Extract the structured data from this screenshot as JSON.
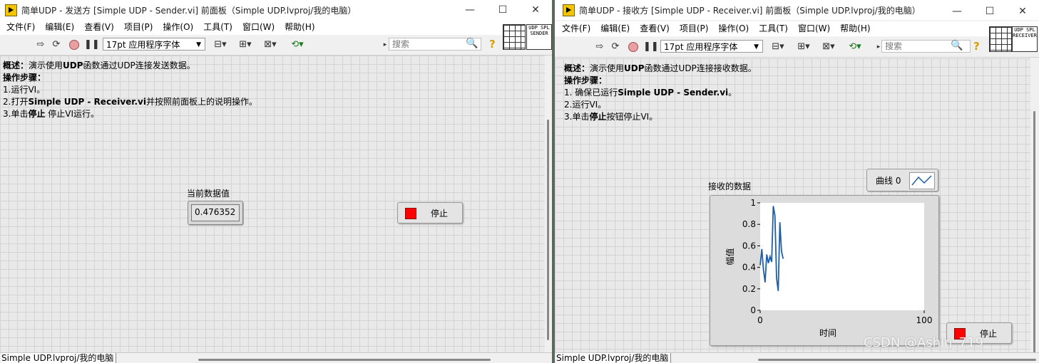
{
  "sender": {
    "title": "简单UDP - 发送方 [Simple UDP - Sender.vi] 前面板（Simple UDP.lvproj/我的电脑）",
    "menu": [
      "文件(F)",
      "编辑(E)",
      "查看(V)",
      "项目(P)",
      "操作(O)",
      "工具(T)",
      "窗口(W)",
      "帮助(H)"
    ],
    "font": "17pt 应用程序字体",
    "search_placeholder": "搜索",
    "vi_icon_text": "UDP SPL SENDER",
    "desc": {
      "l1_prefix": "概述：",
      "l1_a": "演示使用",
      "l1_bold": "UDP",
      "l1_b": "函数通过UDP连接发送数据。",
      "l2": "操作步骤：",
      "l3": "1.运行VI。",
      "l4_a": "2.打开",
      "l4_bold": "Simple UDP - Receiver.vi",
      "l4_b": "并按照前面板上的说明操作。",
      "l5_a": "3.单击",
      "l5_bold": "停止",
      "l5_b": " 停止VI运行。"
    },
    "indicator_label": "当前数据值",
    "indicator_value": "0.476352",
    "stop_label": "停止",
    "status": "Simple UDP.lvproj/我的电脑"
  },
  "receiver": {
    "title": "简单UDP - 接收方 [Simple UDP - Receiver.vi] 前面板（Simple UDP.lvproj/我的电脑）",
    "menu": [
      "文件(F)",
      "编辑(E)",
      "查看(V)",
      "项目(P)",
      "操作(O)",
      "工具(T)",
      "窗口(W)",
      "帮助(H)"
    ],
    "font": "17pt 应用程序字体",
    "search_placeholder": "搜索",
    "vi_icon_text": "UDP SPL RECEIVER",
    "desc": {
      "l1_prefix": "概述：",
      "l1_a": "演示使用",
      "l1_bold": "UDP",
      "l1_b": "函数通过UDP连接接收数据。",
      "l2": "操作步骤：",
      "l3_a": "1. 确保已运行",
      "l3_bold": "Simple UDP - Sender.vi",
      "l3_b": "。",
      "l4": "2.运行VI。",
      "l5_a": "3.单击",
      "l5_bold": "停止",
      "l5_b": "按钮停止VI。"
    },
    "graph_label": "接收的数据",
    "legend_label": "曲线 0",
    "stop_label": "停止",
    "status": "Simple UDP.lvproj/我的电脑"
  },
  "watermark": "CSDN @Ashin_719",
  "chart_data": {
    "type": "line",
    "xlabel": "时间",
    "ylabel": "幅值",
    "xlim": [
      0,
      100
    ],
    "ylim": [
      0,
      1
    ],
    "x_ticks": [
      "0",
      "100"
    ],
    "y_ticks": [
      "0",
      "0.2",
      "0.4",
      "0.6",
      "0.8",
      "1"
    ],
    "series": [
      {
        "name": "曲线 0",
        "color": "#1f5fa8",
        "x": [
          0,
          1,
          2,
          3,
          4,
          5,
          6,
          7,
          8,
          9,
          10,
          11,
          12,
          13,
          14
        ],
        "y": [
          0.42,
          0.57,
          0.38,
          0.26,
          0.52,
          0.44,
          0.5,
          0.45,
          0.97,
          0.88,
          0.3,
          0.18,
          0.82,
          0.55,
          0.48
        ]
      }
    ],
    "colors": {
      "series": "#1f5fa8"
    }
  }
}
